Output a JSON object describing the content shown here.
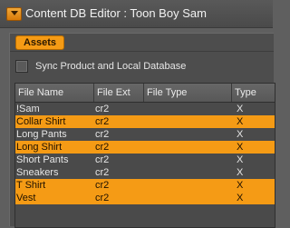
{
  "window": {
    "title": "Content DB Editor : Toon Boy Sam",
    "icon": "app-logo-icon"
  },
  "tabs": [
    {
      "label": "Assets",
      "active": true
    }
  ],
  "sync": {
    "label": "Sync Product and Local Database",
    "checked": false
  },
  "table": {
    "columns": [
      "File Name",
      "File Ext",
      "File Type",
      "Type"
    ],
    "rows": [
      {
        "name": "!Sam",
        "ext": "cr2",
        "file_type": "",
        "type": "X"
      },
      {
        "name": "Collar Shirt",
        "ext": "cr2",
        "file_type": "",
        "type": "X"
      },
      {
        "name": "Long Pants",
        "ext": "cr2",
        "file_type": "",
        "type": "X"
      },
      {
        "name": "Long Shirt",
        "ext": "cr2",
        "file_type": "",
        "type": "X"
      },
      {
        "name": "Short Pants",
        "ext": "cr2",
        "file_type": "",
        "type": "X"
      },
      {
        "name": "Sneakers",
        "ext": "cr2",
        "file_type": "",
        "type": "X"
      },
      {
        "name": "T Shirt",
        "ext": "cr2",
        "file_type": "",
        "type": "X"
      },
      {
        "name": "Vest",
        "ext": "cr2",
        "file_type": "",
        "type": "X"
      }
    ]
  },
  "colors": {
    "accent": "#f59b15",
    "background": "#5f5f5f",
    "panel": "#4d4d4d"
  }
}
